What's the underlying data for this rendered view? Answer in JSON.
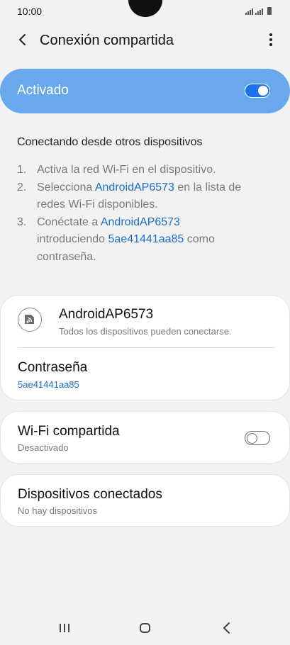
{
  "status": {
    "time": "10:00"
  },
  "header": {
    "title": "Conexión compartida"
  },
  "master_toggle": {
    "label": "Activado",
    "state": "on"
  },
  "instructions": {
    "heading": "Conectando desde otros dispositivos",
    "steps": [
      {
        "num": "1.",
        "pre": "Activa la red Wi-Fi en el dispositivo.",
        "link": "",
        "post": "",
        "link2": "",
        "post2": ""
      },
      {
        "num": "2.",
        "pre": "Selecciona ",
        "link": "AndroidAP6573",
        "post": " en la lista de redes Wi-Fi disponibles.",
        "link2": "",
        "post2": ""
      },
      {
        "num": "3.",
        "pre": "Conéctate a ",
        "link": "AndroidAP6573",
        "post": " introduciendo ",
        "link2": "5ae41441aa85",
        "post2": " como contraseña."
      }
    ]
  },
  "hotspot": {
    "name": "AndroidAP6573",
    "subtitle": "Todos los dispositivos pueden conectarse.",
    "password_label": "Contraseña",
    "password_value": "5ae41441aa85"
  },
  "wifi_sharing": {
    "title": "Wi-Fi compartida",
    "subtitle": "Desactivado",
    "state": "off"
  },
  "connected_devices": {
    "title": "Dispositivos conectados",
    "subtitle": "No hay dispositivos"
  },
  "colors": {
    "accent": "#1a73e8",
    "master_bg": "#6aa8ee",
    "link": "#1a6fc9",
    "background": "#f2f2f2"
  },
  "icons": {
    "back": "back-arrow-icon",
    "more": "more-vert-icon",
    "hotspot": "hotspot-icon",
    "nav_recent": "recent-apps-icon",
    "nav_home": "home-icon",
    "nav_back": "nav-back-icon"
  }
}
